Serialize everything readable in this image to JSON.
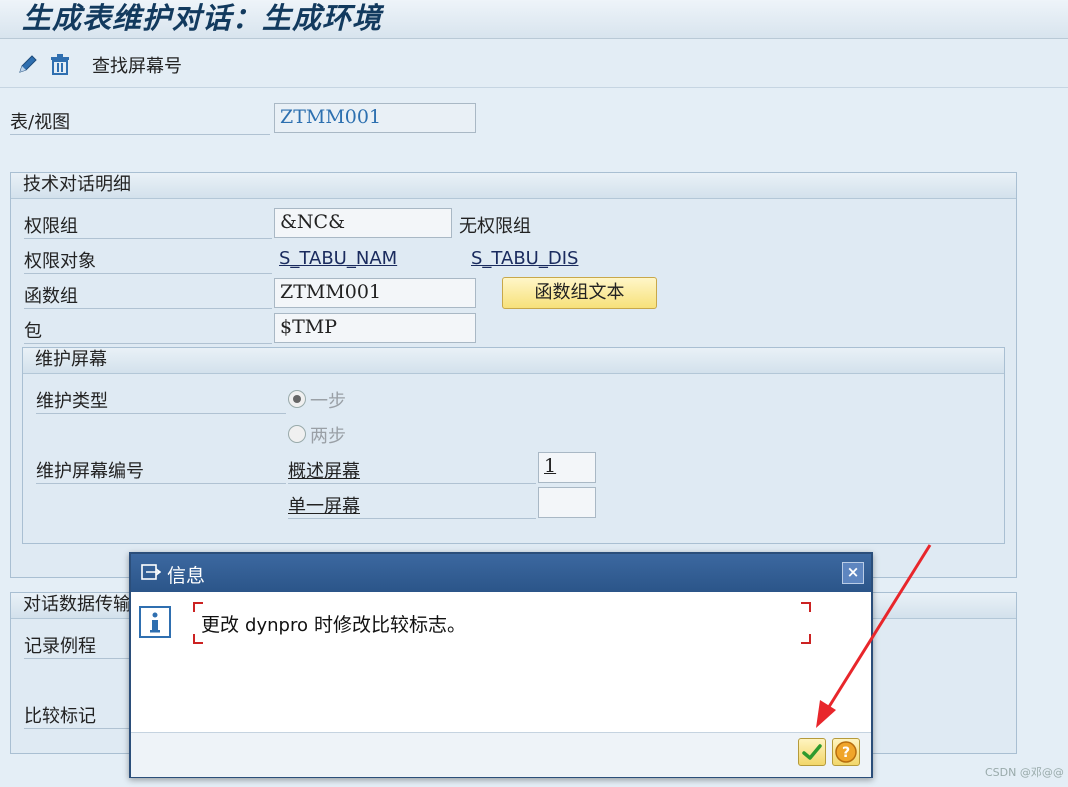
{
  "window": {
    "title": "生成表维护对话：生成环境"
  },
  "toolbar": {
    "edit_icon": "pencil-icon",
    "delete_icon": "trash-icon",
    "find_screen_label": "查找屏幕号"
  },
  "header": {
    "table_view_label": "表/视图",
    "table_view_value": "ZTMM001"
  },
  "tech_group": {
    "title": "技术对话明细",
    "auth_group_label": "权限组",
    "auth_group_value": "&NC&",
    "auth_group_text": "无权限组",
    "auth_object_label": "权限对象",
    "auth_object_1": "S_TABU_NAM",
    "auth_object_2": "S_TABU_DIS",
    "function_group_label": "函数组",
    "function_group_value": "ZTMM001",
    "function_group_text_button": "函数组文本",
    "package_label": "包",
    "package_value": "$TMP"
  },
  "maint_screen": {
    "title": "维护屏幕",
    "type_label": "维护类型",
    "one_step": "一步",
    "two_step": "两步",
    "screen_no_label": "维护屏幕编号",
    "overview_label": "概述屏幕",
    "overview_value": "1",
    "single_label": "单一屏幕",
    "single_value": ""
  },
  "dialog_data": {
    "title": "对话数据传输",
    "record_routine_label": "记录例程",
    "compare_flag_label": "比较标记"
  },
  "dialog": {
    "title": "信息",
    "message_a": "更改 ",
    "message_b": "dynpro",
    "message_c": " 时修改比较标志。",
    "confirm_icon": "checkmark-icon",
    "help_icon": "help-icon"
  },
  "colors": {
    "title_bar_dialog": "#2b5589",
    "accent_yellow": "#f7e17a",
    "arrow_red": "#e8262b"
  },
  "watermark": "CSDN @邓@@"
}
